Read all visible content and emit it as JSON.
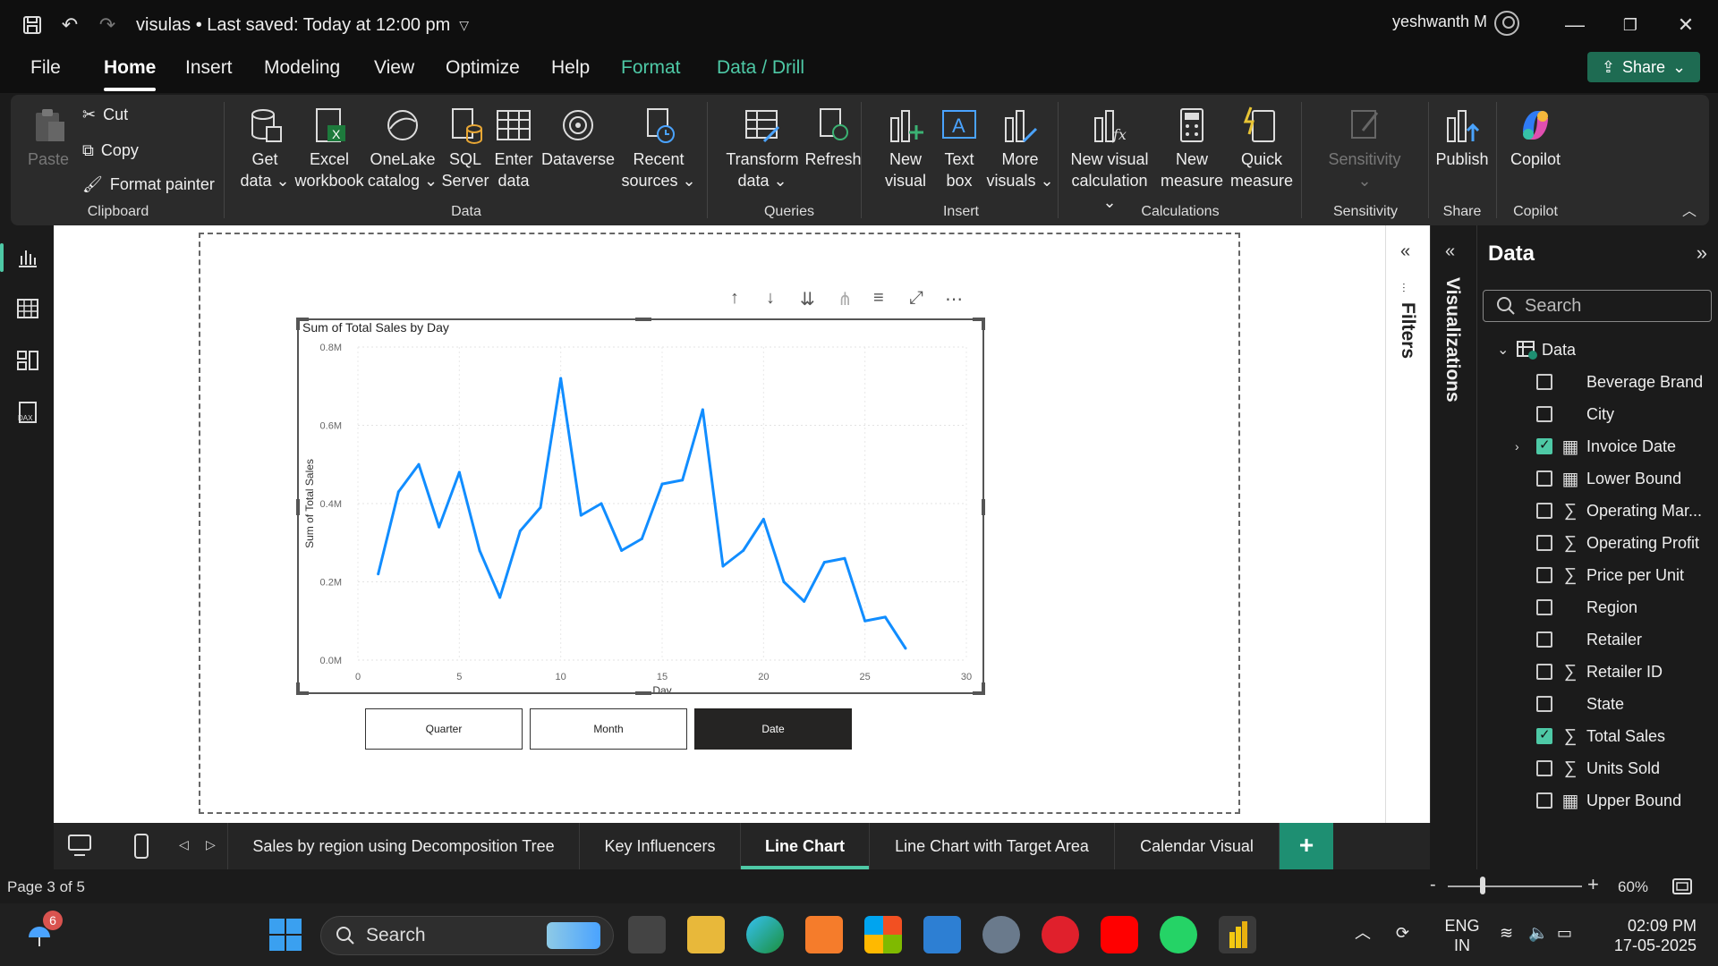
{
  "titlebar": {
    "doc_title": "visulas • Last saved: Today at 12:00 pm",
    "user": "yeshwanth M"
  },
  "menu": {
    "items": [
      "File",
      "Home",
      "Insert",
      "Modeling",
      "View",
      "Optimize",
      "Help",
      "Format",
      "Data / Drill"
    ],
    "active": "Home",
    "share_label": "Share"
  },
  "ribbon": {
    "clipboard": {
      "paste": "Paste",
      "cut": "Cut",
      "copy": "Copy",
      "format_painter": "Format painter",
      "label": "Clipboard"
    },
    "data": {
      "get_data": [
        "Get",
        "data ⌄"
      ],
      "excel": [
        "Excel",
        "workbook"
      ],
      "onelake": [
        "OneLake",
        "catalog ⌄"
      ],
      "sql": [
        "SQL",
        "Server"
      ],
      "enter": [
        "Enter",
        "data"
      ],
      "dataverse": "Dataverse",
      "recent": [
        "Recent",
        "sources ⌄"
      ],
      "label": "Data"
    },
    "queries": {
      "transform": [
        "Transform",
        "data ⌄"
      ],
      "refresh": "Refresh",
      "label": "Queries"
    },
    "insert": {
      "new_visual": [
        "New",
        "visual"
      ],
      "text_box": [
        "Text",
        "box"
      ],
      "more_visuals": [
        "More",
        "visuals ⌄"
      ],
      "label": "Insert"
    },
    "calculations": {
      "new_visual_calc": [
        "New visual",
        "calculation ⌄"
      ],
      "new_measure": [
        "New",
        "measure"
      ],
      "quick_measure": [
        "Quick",
        "measure"
      ],
      "label": "Calculations"
    },
    "sensitivity": {
      "btn": [
        "Sensitivity",
        "⌄"
      ],
      "label": "Sensitivity"
    },
    "share": {
      "publish": "Publish",
      "label": "Share"
    },
    "copilot": {
      "btn": "Copilot",
      "label": "Copilot"
    }
  },
  "visual": {
    "title": "Sum of Total Sales by Day"
  },
  "chart_data": {
    "type": "line",
    "title": "Sum of Total Sales by Day",
    "xlabel": "Day",
    "ylabel": "Sum of Total Sales",
    "xlim": [
      0,
      30
    ],
    "ylim": [
      0,
      0.8
    ],
    "x_ticks": [
      "0",
      "5",
      "10",
      "15",
      "20",
      "25",
      "30"
    ],
    "y_ticks": [
      "0.0M",
      "0.2M",
      "0.4M",
      "0.6M",
      "0.8M"
    ],
    "grid": true,
    "color": "#118DFF",
    "x": [
      1,
      2,
      3,
      4,
      5,
      6,
      7,
      8,
      9,
      10,
      11,
      12,
      13,
      14,
      15,
      16,
      17,
      18,
      19,
      20,
      21,
      22,
      23,
      24,
      25,
      26,
      27
    ],
    "values": [
      0.22,
      0.43,
      0.5,
      0.34,
      0.48,
      0.28,
      0.16,
      0.33,
      0.39,
      0.72,
      0.37,
      0.4,
      0.28,
      0.31,
      0.45,
      0.46,
      0.64,
      0.24,
      0.28,
      0.36,
      0.2,
      0.15,
      0.25,
      0.26,
      0.1,
      0.11,
      0.03
    ]
  },
  "slicer": {
    "buttons": [
      "Quarter",
      "Month",
      "Date"
    ],
    "selected": "Date"
  },
  "panes": {
    "filters": "Filters",
    "visualizations": "Visualizations",
    "data_title": "Data",
    "search_placeholder": "Search",
    "table_name": "Data",
    "fields": [
      {
        "name": "Beverage Brand",
        "glyph": "",
        "checked": false
      },
      {
        "name": "City",
        "glyph": "",
        "checked": false
      },
      {
        "name": "Invoice Date",
        "glyph": "calendar",
        "checked": true
      },
      {
        "name": "Lower Bound",
        "glyph": "calc",
        "checked": false
      },
      {
        "name": "Operating Mar...",
        "glyph": "sigma",
        "checked": false
      },
      {
        "name": "Operating Profit",
        "glyph": "sigma",
        "checked": false
      },
      {
        "name": "Price per Unit",
        "glyph": "sigma",
        "checked": false
      },
      {
        "name": "Region",
        "glyph": "",
        "checked": false
      },
      {
        "name": "Retailer",
        "glyph": "",
        "checked": false
      },
      {
        "name": "Retailer ID",
        "glyph": "sigma",
        "checked": false
      },
      {
        "name": "State",
        "glyph": "",
        "checked": false
      },
      {
        "name": "Total Sales",
        "glyph": "sigma",
        "checked": true
      },
      {
        "name": "Units Sold",
        "glyph": "sigma",
        "checked": false
      },
      {
        "name": "Upper Bound",
        "glyph": "calc",
        "checked": false
      }
    ]
  },
  "pages": {
    "tabs": [
      "Sales by region using Decomposition Tree",
      "Key Influencers",
      "Line Chart",
      "Line Chart with Target Area",
      "Calendar Visual"
    ],
    "active": "Line Chart"
  },
  "status": {
    "page_info": "Page 3 of 5",
    "zoom": "60%"
  },
  "taskbar": {
    "search": "Search",
    "weather_badge": "6",
    "lang": [
      "ENG",
      "IN"
    ],
    "time": "02:09 PM",
    "date": "17-05-2025"
  }
}
